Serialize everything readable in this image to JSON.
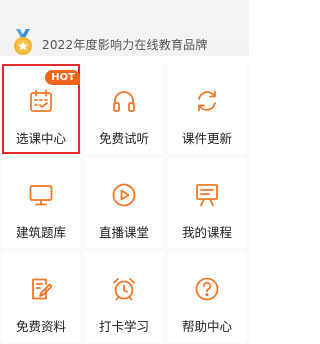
{
  "banner": {
    "text": "2022年度影响力在线教育品牌"
  },
  "grid": {
    "items": [
      {
        "label": "选课中心",
        "icon": "calendar-icon",
        "badge": "HOT",
        "selected": true
      },
      {
        "label": "免费试听",
        "icon": "headphones-icon"
      },
      {
        "label": "课件更新",
        "icon": "refresh-icon"
      },
      {
        "label": "建筑题库",
        "icon": "monitor-icon"
      },
      {
        "label": "直播课堂",
        "icon": "play-circle-icon"
      },
      {
        "label": "我的课程",
        "icon": "presentation-board-icon"
      },
      {
        "label": "免费资料",
        "icon": "document-edit-icon"
      },
      {
        "label": "打卡学习",
        "icon": "alarm-clock-icon"
      },
      {
        "label": "帮助中心",
        "icon": "help-circle-icon"
      }
    ]
  },
  "colors": {
    "accent": "#f0782d",
    "selected_border": "#e02b2b",
    "hot_badge": "#f0641e"
  }
}
